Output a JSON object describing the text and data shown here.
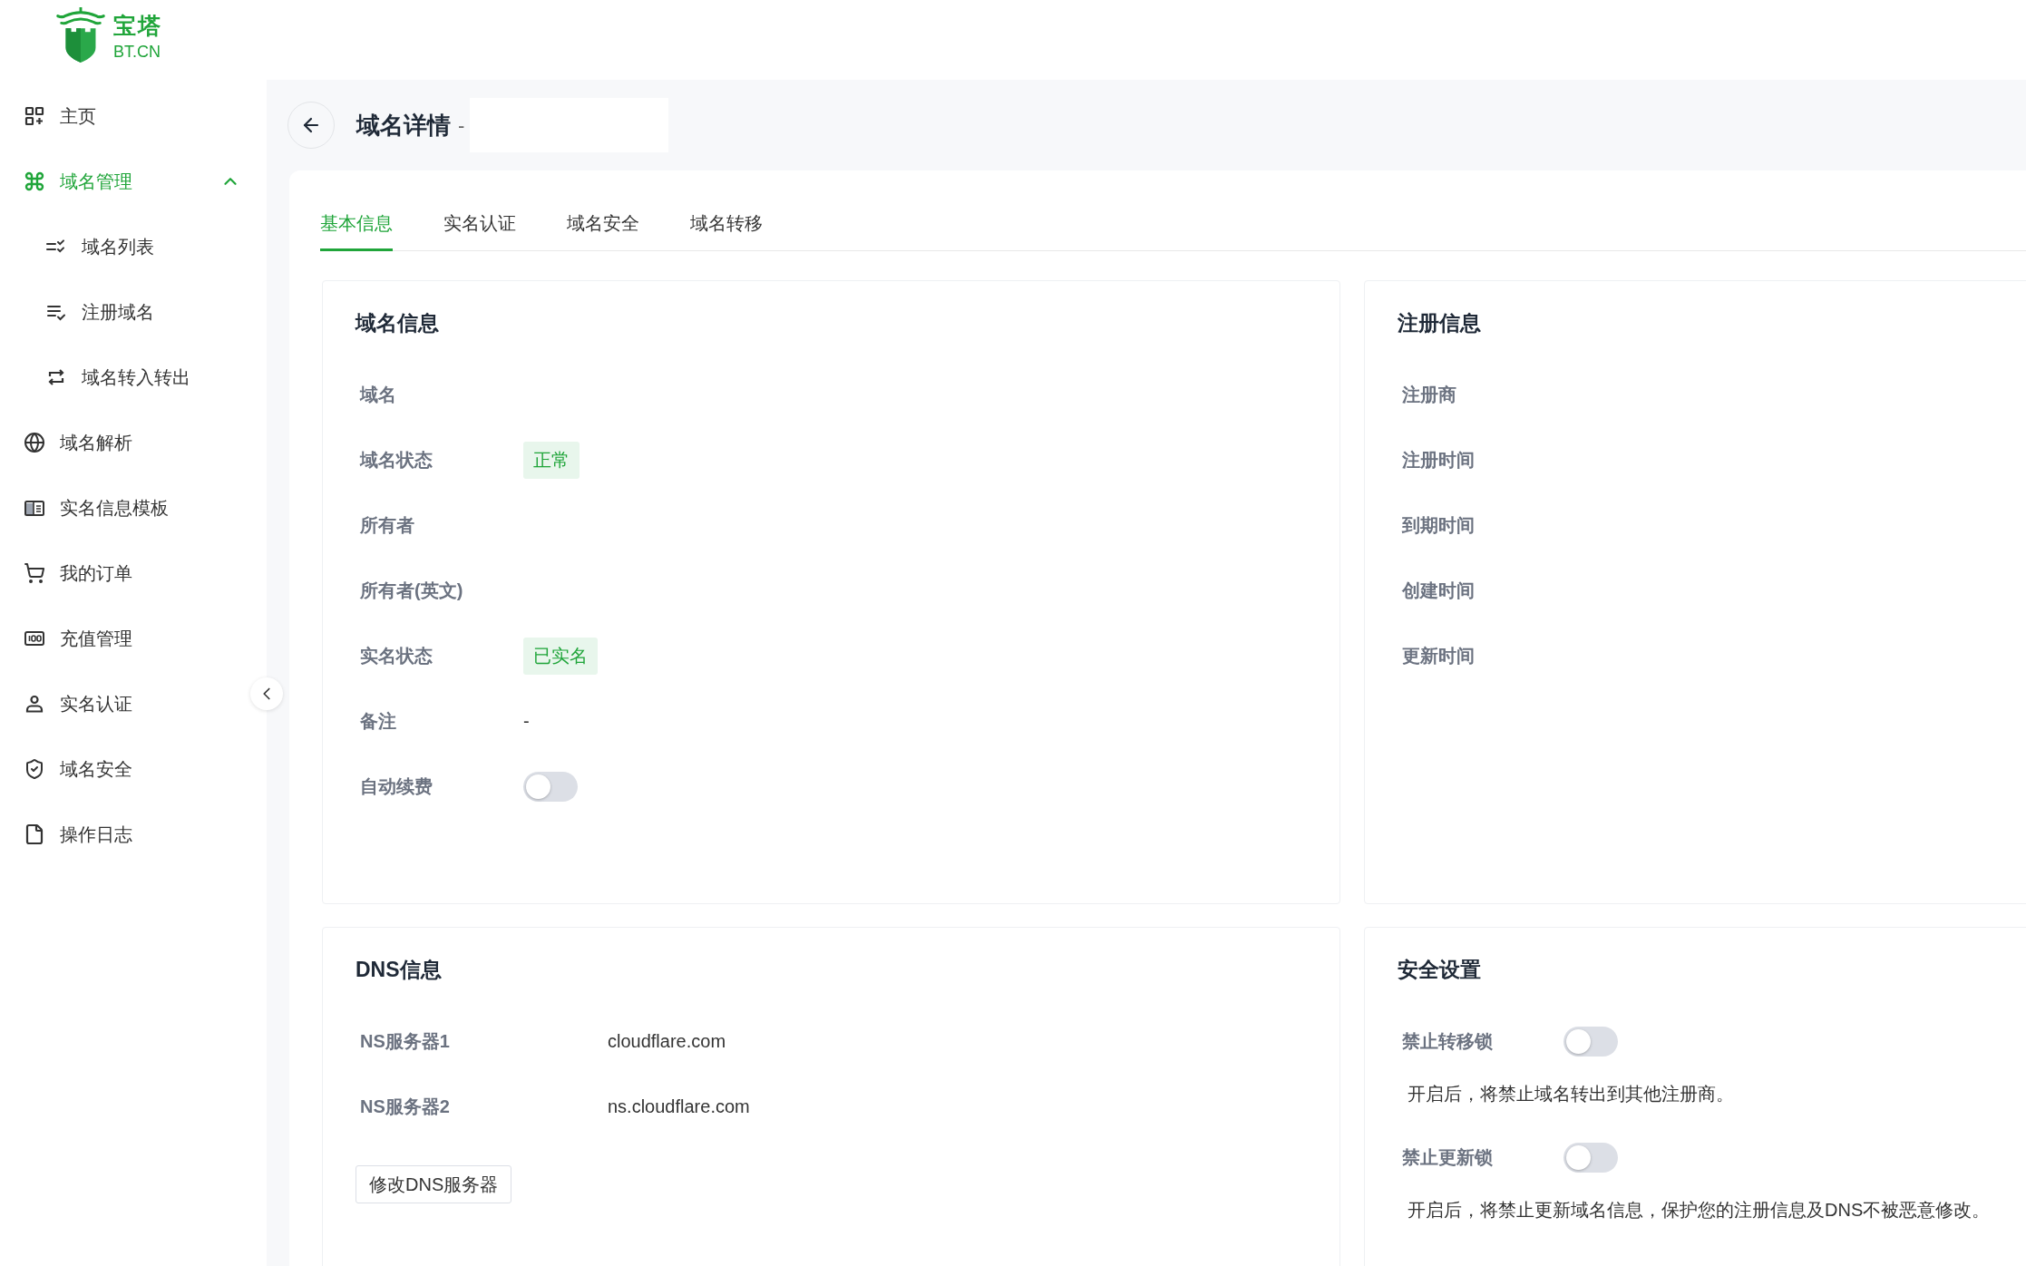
{
  "logo": {
    "name": "宝塔",
    "domain": "BT.CN"
  },
  "sidebar": {
    "items": [
      {
        "label": "主页",
        "selected": false
      },
      {
        "label": "域名管理",
        "selected": true,
        "expanded": true,
        "children": [
          {
            "label": "域名列表",
            "selected": false
          },
          {
            "label": "注册域名",
            "selected": false
          },
          {
            "label": "域名转入转出",
            "selected": false
          }
        ]
      },
      {
        "label": "域名解析",
        "selected": false
      },
      {
        "label": "实名信息模板",
        "selected": false
      },
      {
        "label": "我的订单",
        "selected": false
      },
      {
        "label": "充值管理",
        "selected": false
      },
      {
        "label": "实名认证",
        "selected": false
      },
      {
        "label": "域名安全",
        "selected": false
      },
      {
        "label": "操作日志",
        "selected": false
      }
    ]
  },
  "header": {
    "title": "域名详情",
    "separator": "-"
  },
  "tabs": [
    {
      "label": "基本信息",
      "selected": true
    },
    {
      "label": "实名认证",
      "selected": false
    },
    {
      "label": "域名安全",
      "selected": false
    },
    {
      "label": "域名转移",
      "selected": false
    }
  ],
  "domain_info": {
    "title": "域名信息",
    "rows": [
      {
        "label": "域名",
        "kind": "blank"
      },
      {
        "label": "域名状态",
        "kind": "badge",
        "value": "正常"
      },
      {
        "label": "所有者",
        "kind": "blank"
      },
      {
        "label": "所有者(英文)",
        "kind": "blank"
      },
      {
        "label": "实名状态",
        "kind": "badge",
        "value": "已实名"
      },
      {
        "label": "备注",
        "kind": "text",
        "value": "-"
      },
      {
        "label": "自动续费",
        "kind": "toggle",
        "on": false
      }
    ]
  },
  "registration_info": {
    "title": "注册信息",
    "rows": [
      {
        "label": "注册商"
      },
      {
        "label": "注册时间"
      },
      {
        "label": "到期时间"
      },
      {
        "label": "创建时间"
      },
      {
        "label": "更新时间"
      }
    ]
  },
  "dns_info": {
    "title": "DNS信息",
    "rows": [
      {
        "label": "NS服务器1",
        "value": "cloudflare.com"
      },
      {
        "label": "NS服务器2",
        "value": "ns.cloudflare.com"
      }
    ],
    "button": "修改DNS服务器"
  },
  "security": {
    "title": "安全设置",
    "items": [
      {
        "label": "禁止转移锁",
        "on": false,
        "description": "开启后，将禁止域名转出到其他注册商。"
      },
      {
        "label": "禁止更新锁",
        "on": false,
        "description": "开启后，将禁止更新域名信息，保护您的注册信息及DNS不被恶意修改。"
      }
    ]
  }
}
